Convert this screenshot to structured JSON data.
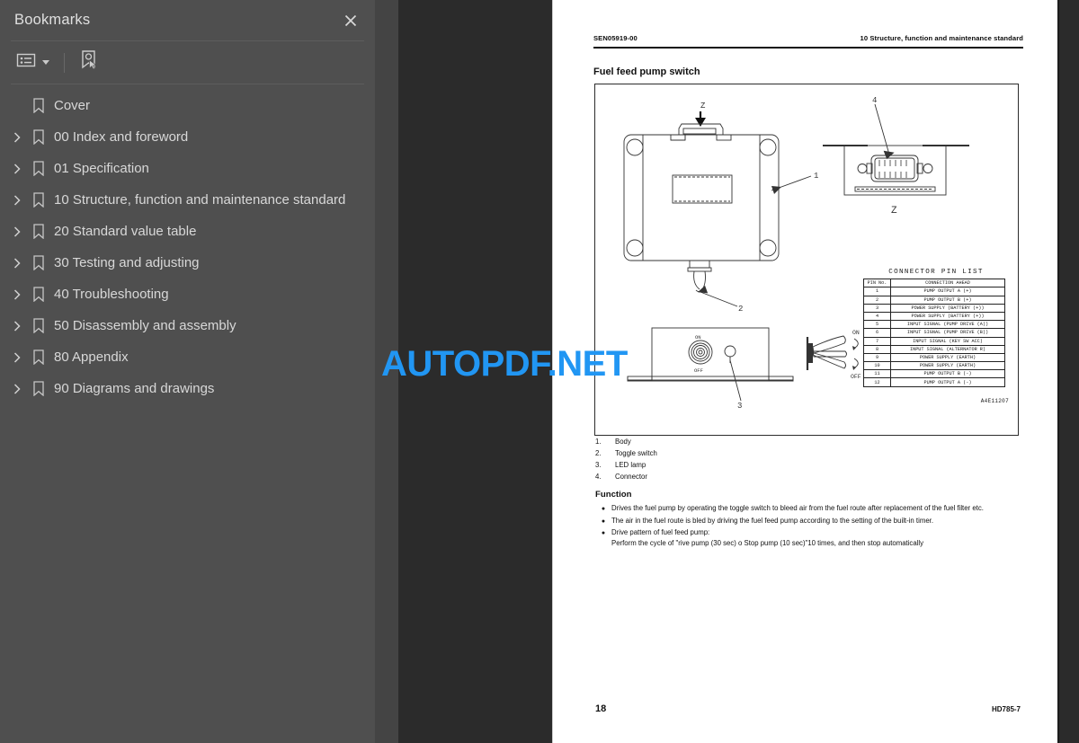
{
  "sidebar": {
    "title": "Bookmarks",
    "close_icon": "close-icon",
    "toolbar": {
      "options_icon": "list-options-icon",
      "caret_icon": "chevron-down-icon",
      "new_bookmark_icon": "bookmark-pointer-icon"
    },
    "items": [
      {
        "label": "Cover",
        "expandable": false
      },
      {
        "label": "00 Index and foreword",
        "expandable": true
      },
      {
        "label": "01 Specification",
        "expandable": true
      },
      {
        "label": "10 Structure, function and maintenance standard",
        "expandable": true
      },
      {
        "label": "20 Standard value table",
        "expandable": true
      },
      {
        "label": "30 Testing and adjusting",
        "expandable": true
      },
      {
        "label": "40 Troubleshooting",
        "expandable": true
      },
      {
        "label": "50 Disassembly and assembly",
        "expandable": true
      },
      {
        "label": "80 Appendix",
        "expandable": true
      },
      {
        "label": "90 Diagrams and drawings",
        "expandable": true
      }
    ]
  },
  "watermark": {
    "text": "AUTOPDF.NET",
    "color": "#2196f3"
  },
  "page": {
    "header_left": "SEN05919-00",
    "header_right": "10 Structure, function and maintenance standard",
    "title": "Fuel feed pump switch",
    "footer_page": "18",
    "footer_model": "HD785-7",
    "figure": {
      "drawing_number": "A4E11207",
      "section_arrow_label": "Z",
      "detail_view_label": "Z",
      "callouts": [
        "1",
        "2",
        "3",
        "4"
      ],
      "switch_labels": {
        "on": "ON",
        "off": "OFF"
      },
      "toggle_labels": {
        "on": "ON",
        "off": "OFF"
      },
      "pin_list": {
        "title": "CONNECTOR PIN LIST",
        "columns": [
          "PIN No.",
          "CONNECTION AHEAD"
        ],
        "rows": [
          [
            "1",
            "PUMP OUTPUT A (+)"
          ],
          [
            "2",
            "PUMP OUTPUT B (+)"
          ],
          [
            "3",
            "POWER SUPPLY  (BATTERY (+))"
          ],
          [
            "4",
            "POWER SUPPLY  (BATTERY (+))"
          ],
          [
            "5",
            "INPUT SIGNAL  (PUMP DRIVE (A))"
          ],
          [
            "6",
            "INPUT SIGNAL  (PUMP DRIVE (B))"
          ],
          [
            "7",
            "INPUT SIGNAL  (KEY SW ACC)"
          ],
          [
            "8",
            "INPUT SIGNAL  (ALTERNATOR R)"
          ],
          [
            "9",
            "POWER SUPPLY  (EARTH)"
          ],
          [
            "10",
            "POWER SUPPLY  (EARTH)"
          ],
          [
            "11",
            "PUMP OUTPUT B (-)"
          ],
          [
            "12",
            "PUMP OUTPUT A (-)"
          ]
        ]
      }
    },
    "parts": [
      {
        "num": "1.",
        "name": "Body"
      },
      {
        "num": "2.",
        "name": "Toggle switch"
      },
      {
        "num": "3.",
        "name": "LED lamp"
      },
      {
        "num": "4.",
        "name": "Connector"
      }
    ],
    "function_heading": "Function",
    "function_items": [
      "Drives the fuel pump by operating the toggle switch to bleed air from the fuel route after replacement of the fuel filter etc.",
      "The air in the fuel route is bled by driving the fuel feed pump according to the setting of the built-in timer.",
      "Drive pattern of fuel feed pump:\nPerform the cycle of \"rive pump (30 sec) o Stop pump (10 sec)\"10 times, and then stop automatically"
    ]
  }
}
